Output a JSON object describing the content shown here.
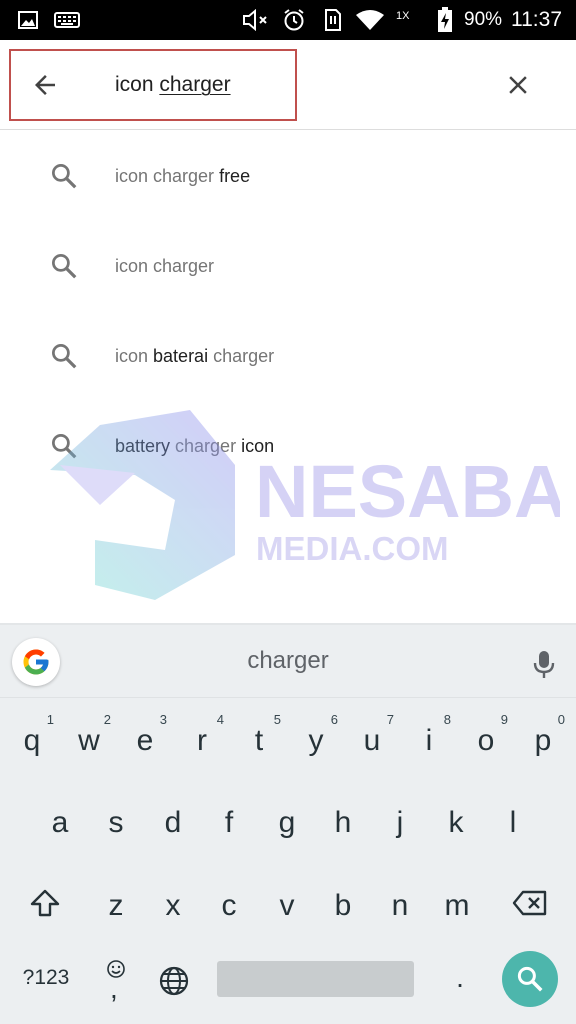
{
  "status_bar": {
    "network": "1X",
    "battery": "90%",
    "time": "11:37",
    "icons": [
      "gallery-icon",
      "keyboard-icon",
      "mute-icon",
      "alarm-icon",
      "sim-icon",
      "wifi-icon",
      "battery-charging-icon"
    ]
  },
  "search": {
    "query_prefix": "icon ",
    "query_composing": "charger",
    "highlight_color": "#c0504d"
  },
  "suggestions": [
    {
      "parts": [
        {
          "text": "icon charger ",
          "style": "grey"
        },
        {
          "text": "free",
          "style": "dark"
        }
      ]
    },
    {
      "parts": [
        {
          "text": "icon charger",
          "style": "grey"
        }
      ]
    },
    {
      "parts": [
        {
          "text": "icon ",
          "style": "grey"
        },
        {
          "text": "baterai",
          "style": "dark"
        },
        {
          "text": " charger",
          "style": "grey"
        }
      ]
    },
    {
      "parts": [
        {
          "text": "battery ",
          "style": "dark"
        },
        {
          "text": "charger",
          "style": "grey"
        },
        {
          "text": " icon",
          "style": "dark"
        }
      ]
    }
  ],
  "watermark": {
    "line1": "NESABA",
    "line2": "MEDIA.COM"
  },
  "keyboard": {
    "suggestion": "charger",
    "row1": [
      {
        "key": "q",
        "hint": "1"
      },
      {
        "key": "w",
        "hint": "2"
      },
      {
        "key": "e",
        "hint": "3"
      },
      {
        "key": "r",
        "hint": "4"
      },
      {
        "key": "t",
        "hint": "5"
      },
      {
        "key": "y",
        "hint": "6"
      },
      {
        "key": "u",
        "hint": "7"
      },
      {
        "key": "i",
        "hint": "8"
      },
      {
        "key": "o",
        "hint": "9"
      },
      {
        "key": "p",
        "hint": "0"
      }
    ],
    "row2": [
      "a",
      "s",
      "d",
      "f",
      "g",
      "h",
      "j",
      "k",
      "l"
    ],
    "row3": [
      "z",
      "x",
      "c",
      "v",
      "b",
      "n",
      "m"
    ],
    "sym_label": "?123",
    "comma_label": ",",
    "period_label": ".",
    "accent_color": "#4db6ac"
  }
}
